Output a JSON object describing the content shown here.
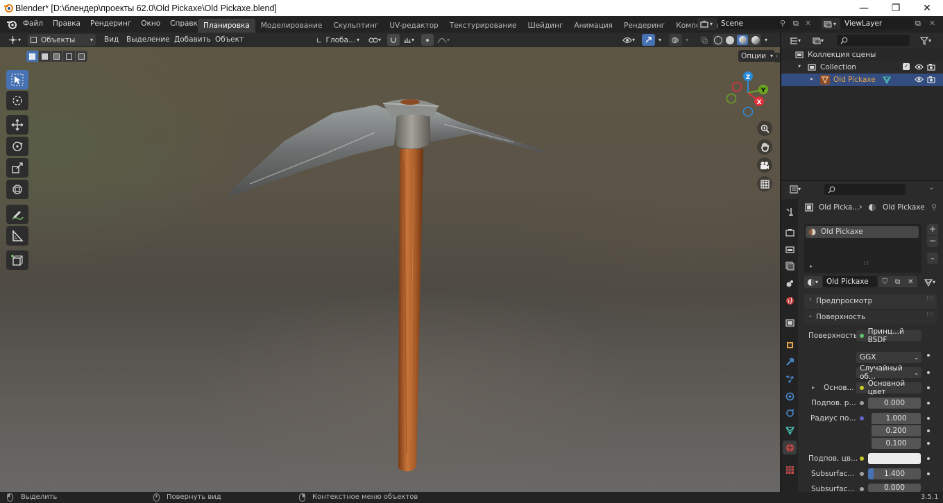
{
  "window": {
    "title": "Blender* [D:\\блендер\\проекты 62.0\\Old Pickaxe\\Old Pickaxe.blend]",
    "minimize": "—",
    "maximize": "❐",
    "close": "✕"
  },
  "menubar": {
    "items": [
      "Файл",
      "Правка",
      "Рендеринг",
      "Окно",
      "Справка"
    ],
    "workspaces": [
      "Планировка",
      "Моделирование",
      "Скульптинг",
      "UV-редактор",
      "Текстурирование",
      "Шейдинг",
      "Анимация",
      "Рендеринг",
      "Композитинг"
    ],
    "active_workspace": "Планировка",
    "scene": "Scene",
    "view_layer": "ViewLayer"
  },
  "viewport_header": {
    "mode": "Объекты",
    "menus": [
      "Вид",
      "Выделение",
      "Добавить",
      "Объект"
    ],
    "orientation": "Глоба...",
    "options": "Опции"
  },
  "viewport": {
    "gizmo": {
      "z": "Z",
      "y": "Y",
      "x": "X"
    }
  },
  "outliner": {
    "scene_collection": "Коллекция сцены",
    "collection": "Collection",
    "object": "Old Pickaxe"
  },
  "properties": {
    "breadcrumb_object": "Old Picka...",
    "breadcrumb_material": "Old Pickaxe",
    "material_slot": "Old Pickaxe",
    "material_name": "Old Pickaxe",
    "panel_preview": "Предпросмотр",
    "panel_surface": "Поверхность",
    "surface_label": "Поверхность",
    "surface_value": "Принц...й BSDF",
    "distribution": "GGX",
    "subsurface_method": "Случайный об...",
    "base_label": "Основ...",
    "base_value": "Основной цвет",
    "subsurface_label": "Подпов. р...",
    "subsurface_value": "0.000",
    "radius_label": "Радиус по...",
    "radius_values": [
      "1.000",
      "0.200",
      "0.100"
    ],
    "subsurface_color_label": "Подпов. цв...",
    "subsurface_ior_label": "Subsurfac...",
    "subsurface_ior_value": "1.400",
    "subsurface_aniso_label": "Subsurfac...",
    "subsurface_aniso_value": "0.000"
  },
  "statusbar": {
    "select": "Выделить",
    "rotate": "Повернуть вид",
    "context": "Контекстное меню объектов",
    "version": "3.5.1"
  },
  "colors": {
    "accent": "#4772b3",
    "header": "#2b2b2b",
    "panel": "#282828",
    "selected_row": "#334d80",
    "object_orange": "#e8a247"
  }
}
